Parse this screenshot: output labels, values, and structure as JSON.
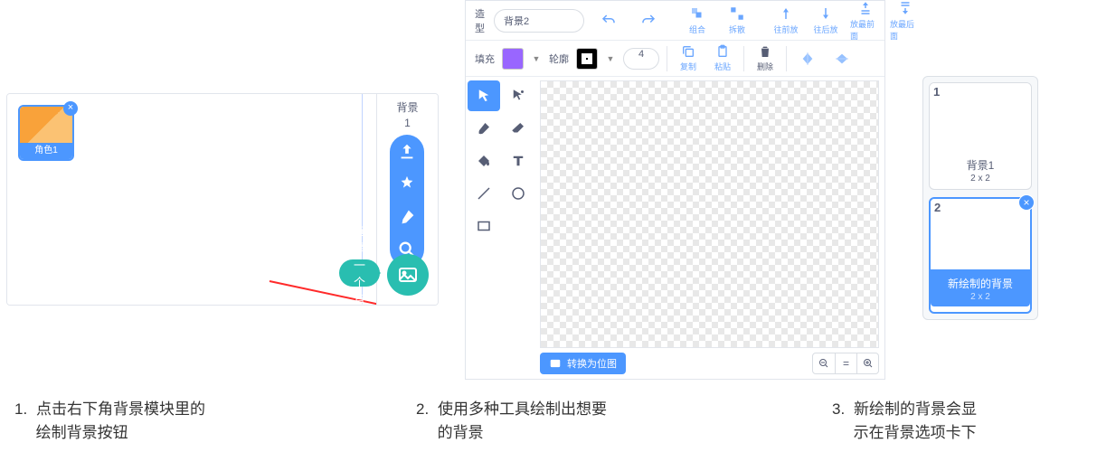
{
  "panel1": {
    "backdrop_header": "背景",
    "backdrop_count": "1",
    "sprite_name": "角色1",
    "tooltip": "选择一个背景",
    "menu_icons": [
      "upload-icon",
      "surprise-icon",
      "paint-icon",
      "search-icon"
    ],
    "fab_icon": "image-icon"
  },
  "editor": {
    "costume_label": "造型",
    "costume_name": "背景2",
    "row1": [
      {
        "id": "undo",
        "label": ""
      },
      {
        "id": "redo",
        "label": ""
      },
      {
        "id": "group",
        "label": "组合"
      },
      {
        "id": "ungroup",
        "label": "拆散"
      },
      {
        "id": "forward",
        "label": "往前放"
      },
      {
        "id": "backward",
        "label": "往后放"
      },
      {
        "id": "front",
        "label": "放最前面"
      },
      {
        "id": "back",
        "label": "放最后面"
      }
    ],
    "fill_label": "填充",
    "outline_label": "轮廓",
    "outline_width": "4",
    "fill_color": "#9966ff",
    "outline_color": "#000000",
    "row2": [
      {
        "id": "copy",
        "label": "复制"
      },
      {
        "id": "paste",
        "label": "粘贴"
      },
      {
        "id": "delete",
        "label": "删除"
      },
      {
        "id": "flip-h",
        "label": ""
      },
      {
        "id": "flip-v",
        "label": ""
      }
    ],
    "tools": [
      "select",
      "reshape",
      "brush",
      "eraser",
      "fill",
      "text",
      "line",
      "circle",
      "rect"
    ],
    "bitmap_btn": "转换为位图"
  },
  "panel3": {
    "items": [
      {
        "num": "1",
        "name": "背景1",
        "size": "2 x 2",
        "selected": false
      },
      {
        "num": "2",
        "name": "新绘制的背景",
        "size": "2 x 2",
        "selected": true
      }
    ]
  },
  "captions": {
    "c1_num": "1.",
    "c1": "点击右下角背景模块里的\n绘制背景按钮",
    "c2_num": "2.",
    "c2": "使用多种工具绘制出想要\n的背景",
    "c3_num": "3.",
    "c3": "新绘制的背景会显\n示在背景选项卡下"
  }
}
